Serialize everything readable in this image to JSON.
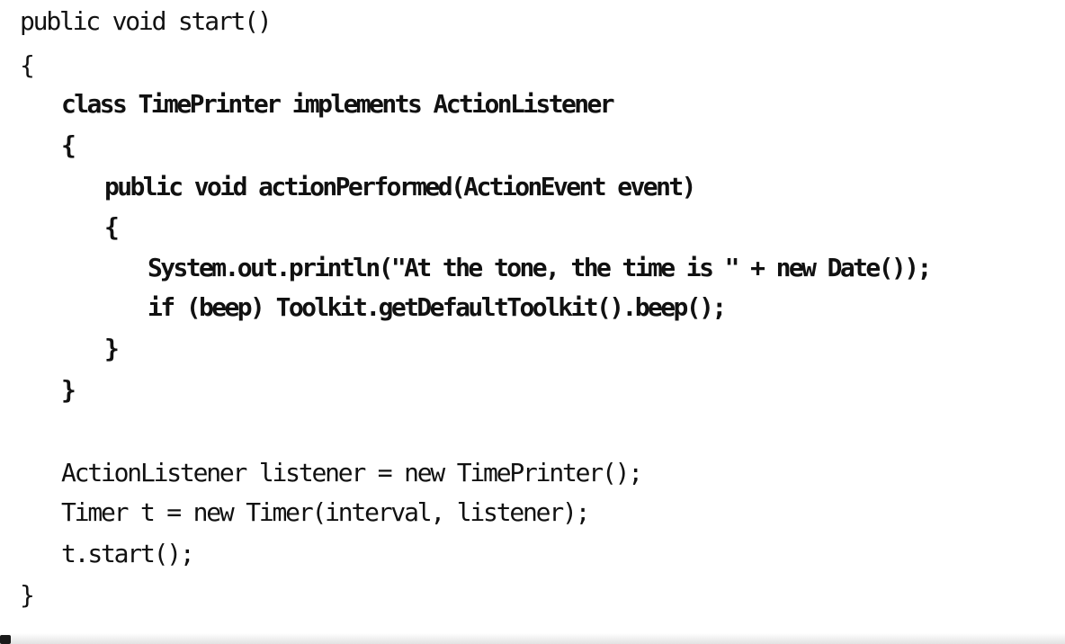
{
  "code": {
    "lines": [
      "public void start()",
      "{",
      "class TimePrinter implements ActionListener",
      "{",
      "public void actionPerformed(ActionEvent event)",
      "{",
      "System.out.println(\"At the tone, the time is \" + new Date());",
      "if (beep) Toolkit.getDefaultToolkit().beep();",
      "}",
      "}",
      "ActionListener listener = new TimePrinter();",
      "Timer t = new Timer(interval, listener);",
      "t.start();",
      "}"
    ]
  }
}
